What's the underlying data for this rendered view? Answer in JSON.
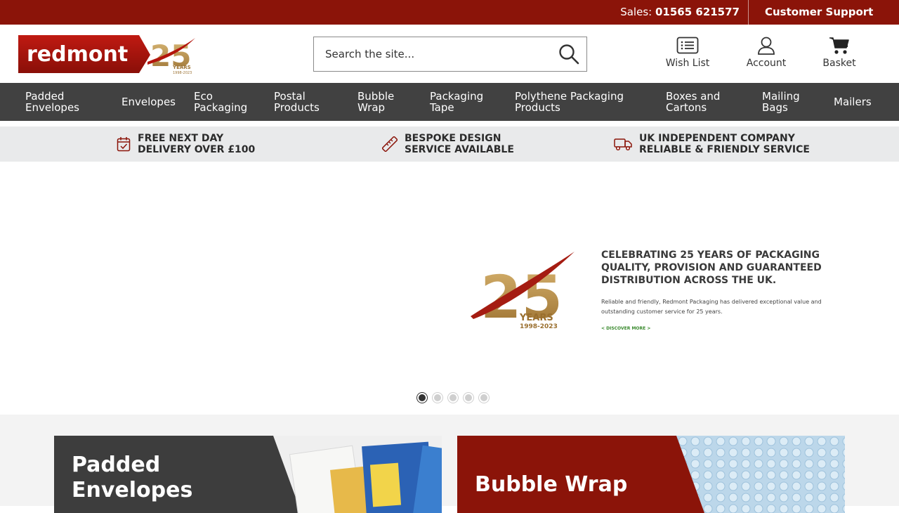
{
  "topbar": {
    "sales_label": "Sales:",
    "sales_number": "01565 621577",
    "support_label": "Customer Support"
  },
  "header": {
    "logo_text": "redmont",
    "logo_years_number": "25",
    "logo_years_word": "YEARS",
    "logo_years_range": "1998-2023",
    "search_placeholder": "Search the site...",
    "wishlist_label": "Wish List",
    "account_label": "Account",
    "basket_label": "Basket"
  },
  "nav": {
    "items": [
      {
        "label": "Padded Envelopes"
      },
      {
        "label": "Envelopes"
      },
      {
        "label": "Eco Packaging"
      },
      {
        "label": "Postal Products"
      },
      {
        "label": "Bubble Wrap"
      },
      {
        "label": "Packaging Tape"
      },
      {
        "label": "Polythene Packaging Products"
      },
      {
        "label": "Boxes and Cartons"
      },
      {
        "label": "Mailing Bags"
      },
      {
        "label": "Mailers"
      }
    ]
  },
  "usp": {
    "items": [
      {
        "line1": "FREE NEXT DAY",
        "line2": "DELIVERY OVER £100",
        "icon": "calendar-check-icon"
      },
      {
        "line1": "BESPOKE DESIGN",
        "line2": "SERVICE AVAILABLE",
        "icon": "ruler-icon"
      },
      {
        "line1": "UK INDEPENDENT COMPANY",
        "line2": "RELIABLE & FRIENDLY SERVICE",
        "icon": "delivery-truck-icon"
      }
    ]
  },
  "hero": {
    "badge_number": "25",
    "badge_word": "YEARS",
    "badge_range": "1998-2023",
    "headline": "CELEBRATING 25 YEARS OF PACKAGING QUALITY, PROVISION AND GUARANTEED DISTRIBUTION ACROSS THE UK.",
    "body": "Reliable and friendly, Redmont Packaging has delivered exceptional value and outstanding customer service for 25 years.",
    "link": "< DISCOVER MORE >",
    "slide_count": 5,
    "active_slide": 1
  },
  "categories": [
    {
      "title_line1": "Padded",
      "title_line2": "Envelopes",
      "color": "#3d3d3d"
    },
    {
      "title_line1": "Bubble Wrap",
      "title_line2": "",
      "color": "#8b1409"
    }
  ],
  "colors": {
    "brand_red": "#8b1409",
    "nav_grey": "#414141",
    "usp_grey": "#e9eaeb",
    "gold": "#b08a4a"
  }
}
